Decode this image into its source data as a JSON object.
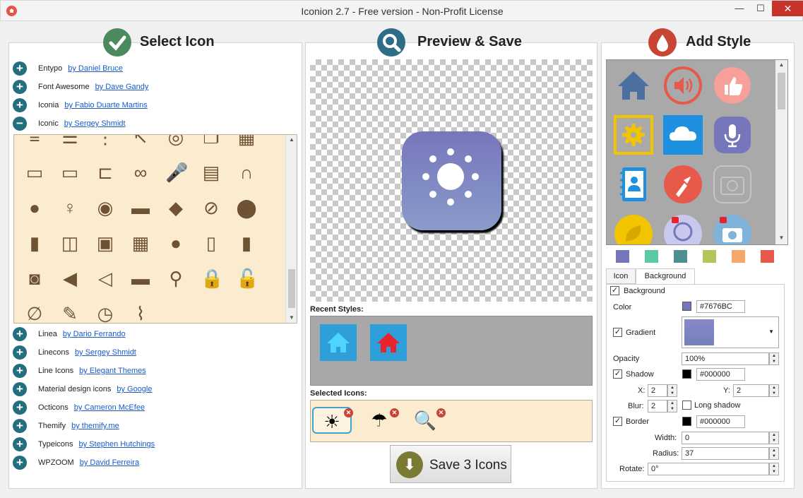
{
  "window": {
    "title": "Iconion 2.7 - Free version - Non-Profit License",
    "min_glyph": "—",
    "max_glyph": "☐",
    "close_glyph": "✕"
  },
  "sections": {
    "select": "Select Icon",
    "preview": "Preview & Save",
    "style": "Add Style"
  },
  "libraries_top": [
    {
      "name": "Entypo",
      "author": "by Daniel Bruce",
      "state": "+"
    },
    {
      "name": "Font Awesome",
      "author": "by Dave Gandy",
      "state": "+"
    },
    {
      "name": "Iconia",
      "author": "by Fabio Duarte Martins",
      "state": "+"
    },
    {
      "name": "Iconic",
      "author": "by Sergey Shmidt",
      "state": "−"
    }
  ],
  "libraries_bottom": [
    {
      "name": "Linea",
      "author": "by Dario Ferrando",
      "state": "+"
    },
    {
      "name": "Linecons",
      "author": "by Sergey Shmidt",
      "state": "+"
    },
    {
      "name": "Line Icons",
      "author": "by Elegant Themes",
      "state": "+"
    },
    {
      "name": "Material design icons",
      "author": "by Google",
      "state": "+"
    },
    {
      "name": "Octicons",
      "author": "by Cameron McEfee",
      "state": "+"
    },
    {
      "name": "Themify",
      "author": "by themify.me",
      "state": "+"
    },
    {
      "name": "Typeicons",
      "author": "by Stephen Hutchings",
      "state": "+"
    },
    {
      "name": "WPZOOM",
      "author": "by David Ferreira",
      "state": "+"
    }
  ],
  "icon_grid": [
    [
      "align-left-icon",
      "list-icon",
      "list-nested-icon",
      "arrow-up-left-icon",
      "target-icon",
      "layers-icon",
      "trash-icon"
    ],
    [
      "battery-low-icon",
      "battery-empty-icon",
      "plug-icon",
      "link-icon",
      "microphone-icon",
      "clapperboard-icon",
      "headphones-icon"
    ],
    [
      "user-icon",
      "lightbulb-icon",
      "disc-icon",
      "folder-icon",
      "tag-icon",
      "pin-link-icon",
      "location-pin-icon"
    ],
    [
      "book-icon",
      "open-book-icon",
      "box-icon",
      "calendar-icon",
      "speech-bubble-icon",
      "phone-icon",
      "bar-chart-icon"
    ],
    [
      "camera-icon",
      "volume-low-icon",
      "volume-high-icon",
      "battery-full-icon",
      "magnifier-icon",
      "lock-closed-icon",
      "lock-open-icon"
    ],
    [
      "paperclip-link-icon",
      "wrench-icon",
      "clock-icon",
      "paperclip-icon"
    ]
  ],
  "icon_glyphs": [
    [
      "≡",
      "☰",
      "⋮",
      "↖",
      "◎",
      "❐",
      "▦"
    ],
    [
      "▭",
      "▭",
      "⊏",
      "∞",
      "🎤",
      "▤",
      "∩"
    ],
    [
      "●",
      "♀",
      "◉",
      "▬",
      "◆",
      "⊘",
      "⬤"
    ],
    [
      "▮",
      "◫",
      "▣",
      "▦",
      "●",
      "▯",
      "▮"
    ],
    [
      "◙",
      "◀",
      "◁",
      "▬",
      "⚲",
      "🔒",
      "🔓"
    ],
    [
      "∅",
      "✎",
      "◷",
      "⌇"
    ]
  ],
  "preview": {
    "recent_label": "Recent Styles:",
    "selected_label": "Selected Icons:",
    "selected_icons": [
      {
        "name": "sun-icon",
        "glyph": "☀"
      },
      {
        "name": "umbrella-icon",
        "glyph": "☂"
      },
      {
        "name": "search-icon",
        "glyph": "🔍"
      }
    ],
    "remove_glyph": "✕",
    "save_label": "Save 3 Icons",
    "save_glyph": "⬇"
  },
  "style_swatches": [
    "#7676bc",
    "#5cc9a6",
    "#4e8f8f",
    "#b3c65a",
    "#f6a76c",
    "#e7594a"
  ],
  "style_tabs": {
    "icon": "Icon",
    "background": "Background"
  },
  "properties": {
    "background_label": "Background",
    "color_label": "Color",
    "color_value": "#7676BC",
    "gradient_label": "Gradient",
    "opacity_label": "Opacity",
    "opacity_value": "100%",
    "shadow_label": "Shadow",
    "shadow_color": "#000000",
    "x_label": "X:",
    "x_value": "2",
    "y_label": "Y:",
    "y_value": "2",
    "blur_label": "Blur:",
    "blur_value": "2",
    "long_shadow_label": "Long shadow",
    "border_label": "Border",
    "border_color": "#000000",
    "width_label": "Width:",
    "width_value": "0",
    "radius_label": "Radius:",
    "radius_value": "37",
    "rotate_label": "Rotate:",
    "rotate_value": "0°"
  },
  "check_glyph": "✓",
  "spin_up": "▲",
  "spin_down": "▼",
  "dropdown_glyph": "▼"
}
